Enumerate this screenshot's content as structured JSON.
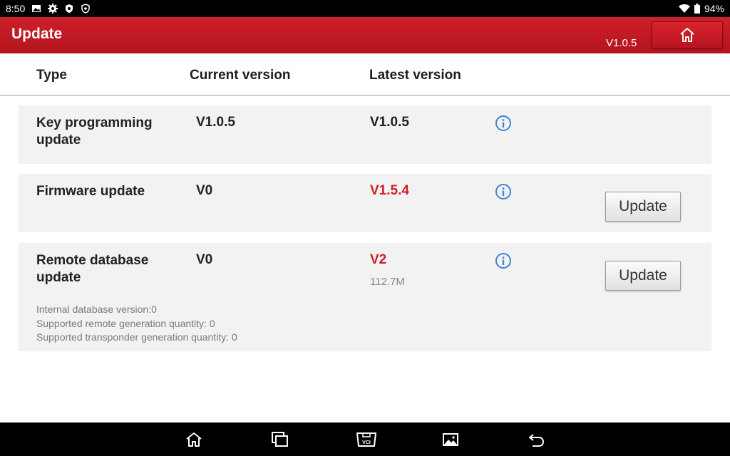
{
  "statusbar": {
    "time": "8:50",
    "battery": "94%"
  },
  "appbar": {
    "title": "Update",
    "version": "V1.0.5"
  },
  "table_header": {
    "type": "Type",
    "current": "Current version",
    "latest": "Latest version"
  },
  "rows": [
    {
      "name": "Key programming update",
      "current": "V1.0.5",
      "latest": "V1.0.5"
    },
    {
      "name": "Firmware update",
      "current": "V0",
      "latest": "V1.5.4",
      "button": "Update"
    },
    {
      "name": "Remote database update",
      "current": "V0",
      "latest": "V2",
      "size": "112.7M",
      "button": "Update",
      "details": [
        "Internal database version:0",
        "Supported remote generation quantity: 0",
        "Supported transponder generation quantity: 0"
      ]
    }
  ],
  "colors": {
    "brand_red": "#cc1f2a",
    "info_blue": "#3a86d8"
  }
}
